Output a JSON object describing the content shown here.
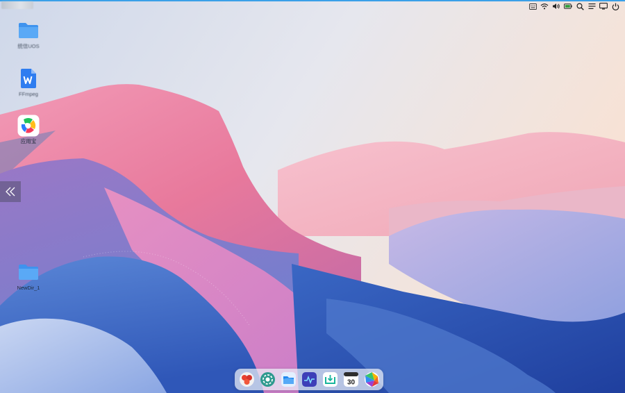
{
  "desktop": {
    "icons": [
      {
        "label": "统信UOS"
      },
      {
        "label": "FFmpeg"
      },
      {
        "label": "应用宝"
      },
      {
        "label": "NewDir_1"
      }
    ]
  },
  "tray": {
    "icons": [
      "input-method-icon",
      "wifi-icon",
      "volume-icon",
      "battery-icon",
      "search-icon",
      "notification-list-icon",
      "screen-icon",
      "power-icon"
    ]
  },
  "dock": {
    "apps": [
      "app-store-icon",
      "settings-icon",
      "file-manager-icon",
      "system-monitor-icon",
      "screenshot-icon",
      "calendar-icon",
      "browser-icon"
    ],
    "calendar_day": "30"
  },
  "colors": {
    "accent": "#3aa0e8",
    "folder": "#4a9ef3"
  }
}
